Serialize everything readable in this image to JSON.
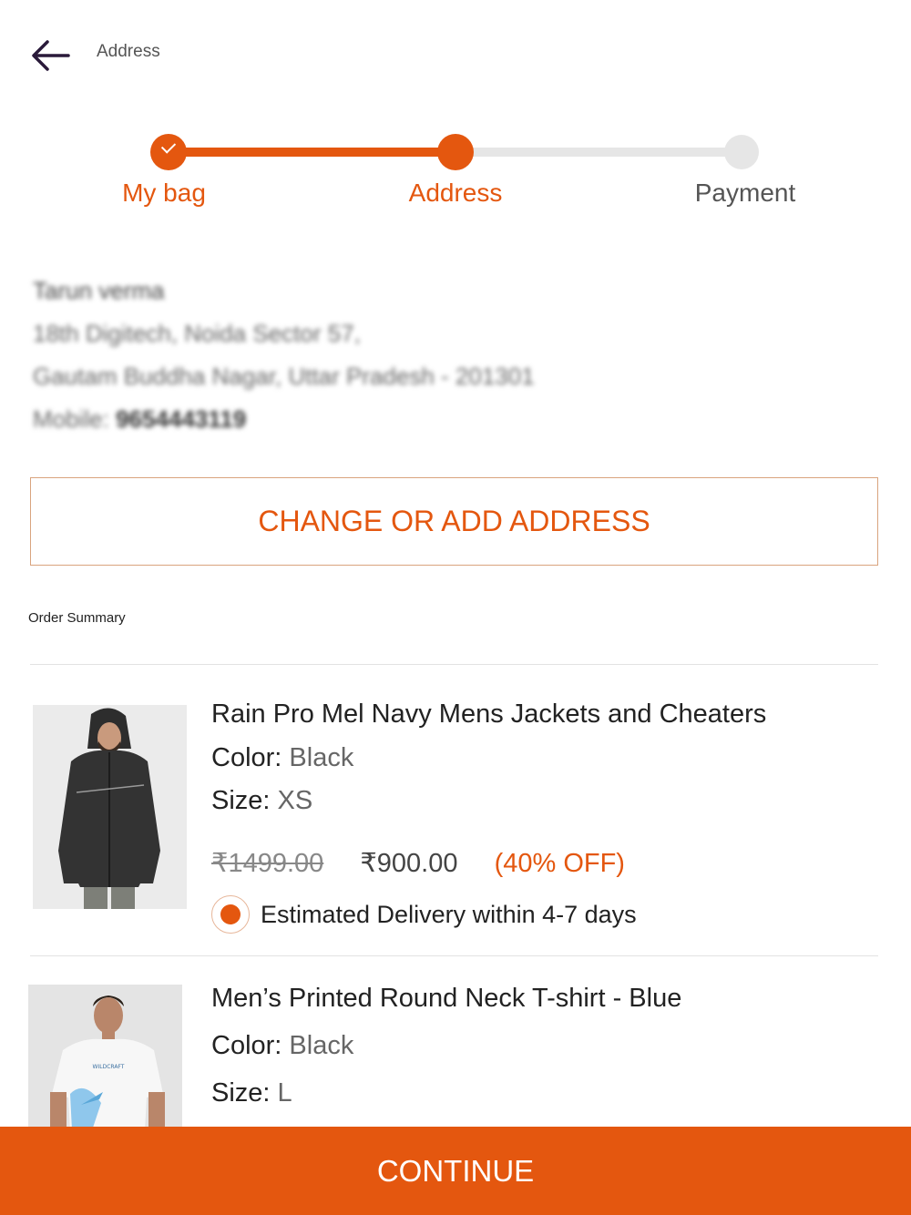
{
  "header": {
    "title": "Address",
    "back_icon": "arrow-left-icon"
  },
  "stepper": {
    "steps": [
      {
        "label": "My bag",
        "state": "completed"
      },
      {
        "label": "Address",
        "state": "current"
      },
      {
        "label": "Payment",
        "state": "upcoming"
      }
    ]
  },
  "address": {
    "name": "Tarun verma",
    "line1": "18th Digitech, Noida Sector 57,",
    "line2": "Gautam Buddha Nagar, Uttar Pradesh - 201301",
    "mobile_label": "Mobile:",
    "mobile_number": "9654443119"
  },
  "change_address_label": "CHANGE OR ADD ADDRESS",
  "order_summary": {
    "title": "Order Summary",
    "items": [
      {
        "name": "Rain Pro Mel Navy Mens Jackets and Cheaters",
        "color_label": "Color:",
        "color_value": "Black",
        "size_label": "Size:",
        "size_value": "XS",
        "mrp": "₹1499.00",
        "price": "₹900.00",
        "discount": "(40% OFF)",
        "delivery": "Estimated Delivery within 4-7 days"
      },
      {
        "name": "Men’s Printed Round Neck T-shirt - Blue",
        "color_label": "Color:",
        "color_value": "Black",
        "size_label": "Size:",
        "size_value": "L"
      }
    ]
  },
  "continue_label": "CONTINUE",
  "colors": {
    "accent": "#e4570f",
    "track_inactive": "#e6e6e6"
  }
}
